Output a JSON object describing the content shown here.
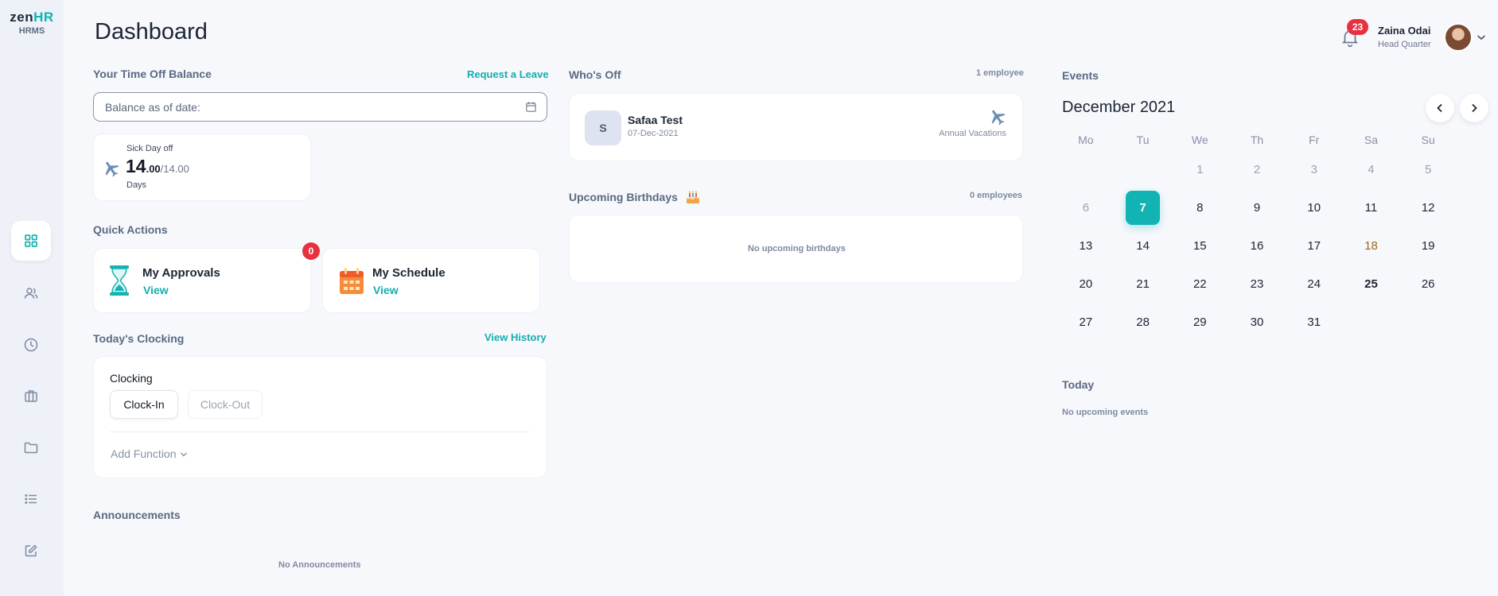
{
  "app": {
    "logo_brand_left": "zen",
    "logo_brand_right": "HR",
    "logo_subtitle": "HRMS"
  },
  "sidebar": {
    "items": [
      {
        "label": "Dashboard",
        "icon": "grid-icon",
        "active": true
      },
      {
        "label": "Employees",
        "icon": "users-icon"
      },
      {
        "label": "Attendance",
        "icon": "clock-icon"
      },
      {
        "label": "Jobs",
        "icon": "briefcase-icon"
      },
      {
        "label": "Documents",
        "icon": "folder-icon"
      },
      {
        "label": "Lists",
        "icon": "list-icon"
      },
      {
        "label": "Requests",
        "icon": "edit-icon"
      }
    ]
  },
  "header": {
    "page_title": "Dashboard",
    "notifications_count": "23",
    "user_name": "Zaina Odai",
    "user_role": "Head Quarter"
  },
  "time_off": {
    "title": "Your Time Off Balance",
    "request_link": "Request a Leave",
    "date_placeholder": "Balance as of date:",
    "balance": {
      "type": "Sick Day off",
      "value_int": "14",
      "value_dec": ".00",
      "total": "/14.00",
      "unit": "Days"
    }
  },
  "quick_actions": {
    "title": "Quick Actions",
    "items": [
      {
        "label": "My Approvals",
        "action": "View",
        "badge": "0",
        "icon": "hourglass-icon"
      },
      {
        "label": "My Schedule",
        "action": "View",
        "icon": "schedule-calendar-icon"
      }
    ]
  },
  "clocking": {
    "title": "Today's Clocking",
    "history_link": "View History",
    "label": "Clocking",
    "clock_in": "Clock-In",
    "clock_out": "Clock-Out",
    "add_function": "Add Function"
  },
  "announcements": {
    "title": "Announcements",
    "empty": "No Announcements"
  },
  "whos_off": {
    "title": "Who's Off",
    "count": "1 employee",
    "entries": [
      {
        "initial": "S",
        "name": "Safaa Test",
        "date": "07-Dec-2021",
        "type": "Annual Vacations"
      }
    ]
  },
  "birthdays": {
    "title": "Upcoming Birthdays",
    "count": "0 employees",
    "empty": "No upcoming birthdays"
  },
  "events": {
    "title": "Events",
    "month": "December 2021",
    "weekdays": [
      "Mo",
      "Tu",
      "We",
      "Th",
      "Fr",
      "Sa",
      "Su"
    ],
    "weeks": [
      [
        "",
        "",
        "1",
        "2",
        "3",
        "4",
        "5"
      ],
      [
        "6",
        "7",
        "8",
        "9",
        "10",
        "11",
        "12"
      ],
      [
        "13",
        "14",
        "15",
        "16",
        "17",
        "18",
        "19"
      ],
      [
        "20",
        "21",
        "22",
        "23",
        "24",
        "25",
        "26"
      ],
      [
        "27",
        "28",
        "29",
        "30",
        "31",
        "",
        ""
      ]
    ],
    "selected_day": "7",
    "today_title": "Today",
    "today_empty": "No upcoming events"
  },
  "colors": {
    "accent": "#12b3b3",
    "badge": "#e8313f",
    "sidebar": "#eef1f8",
    "background": "#f7f8fc"
  }
}
